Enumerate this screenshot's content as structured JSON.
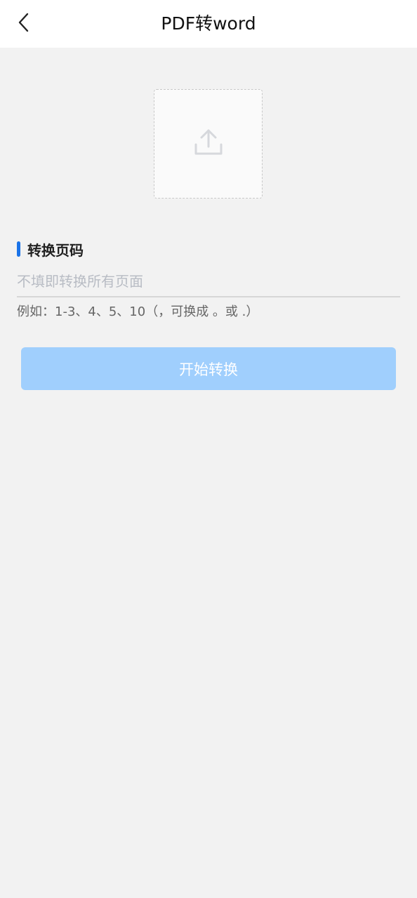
{
  "header": {
    "title": "PDF转word",
    "back_icon": "chevron-left-icon"
  },
  "upload": {
    "icon": "upload-icon",
    "icon_color": "#d6d8dc"
  },
  "pages_section": {
    "label": "转换页码",
    "accent_color": "#1a73e8",
    "input_value": "",
    "input_placeholder": "不填即转换所有页面",
    "hint": "例如：1-3、4、5、10（，可换成 。或 .）"
  },
  "actions": {
    "start_label": "开始转换",
    "button_color": "#a0cffd"
  }
}
